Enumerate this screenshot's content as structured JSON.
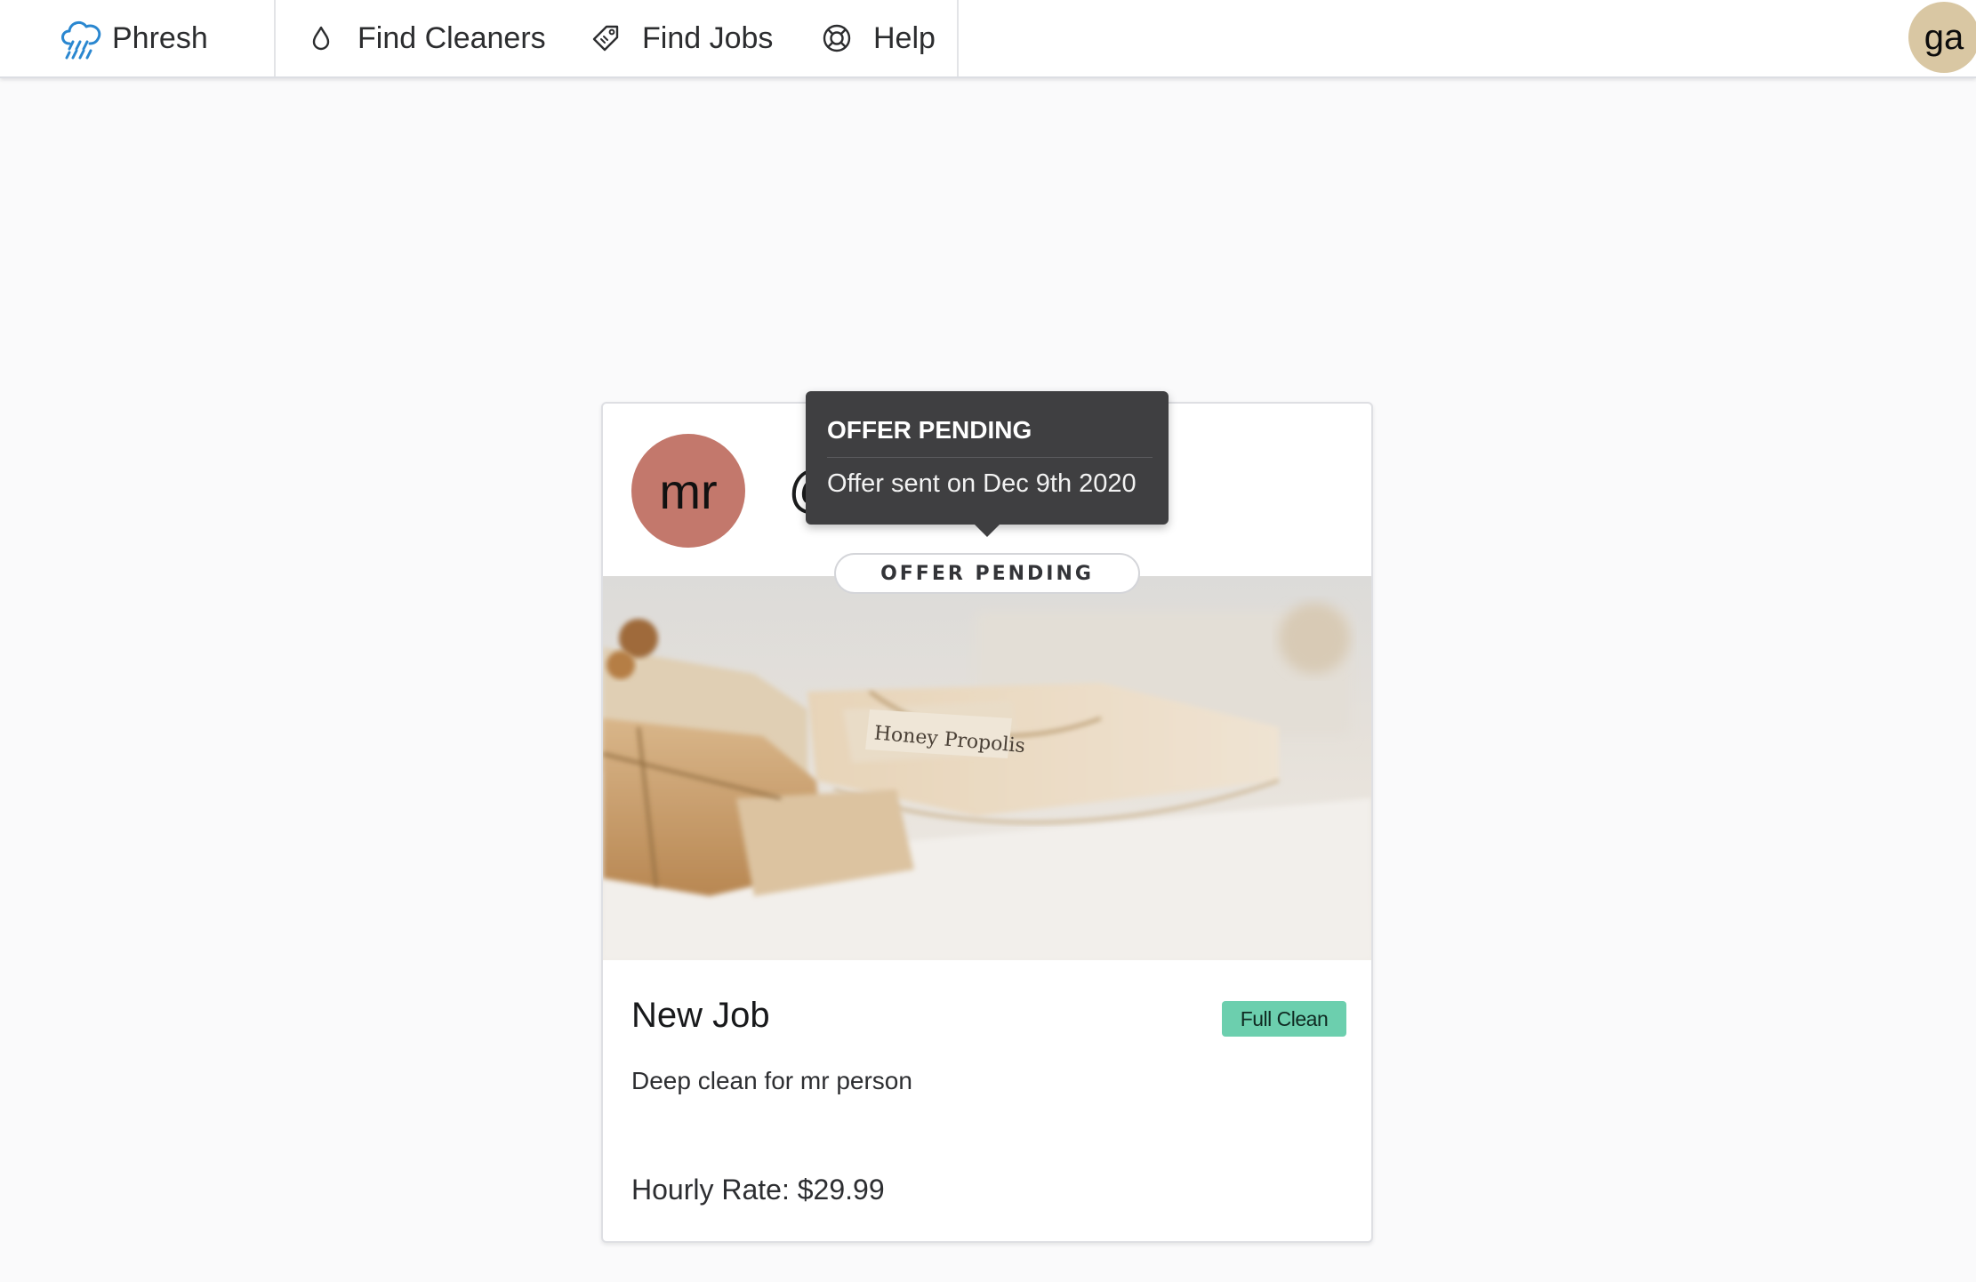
{
  "navbar": {
    "brand": {
      "label": "Phresh",
      "icon": "cloud-rain-icon"
    },
    "items": [
      {
        "label": "Find Cleaners",
        "icon": "droplet-icon"
      },
      {
        "label": "Find Jobs",
        "icon": "tag-icon"
      },
      {
        "label": "Help",
        "icon": "lifebuoy-icon"
      }
    ],
    "user_avatar": "ga",
    "brand_color": "#2a87d0"
  },
  "card": {
    "owner_avatar": "mr",
    "owner_avatar_color": "#c3786c",
    "at_glyph": "@",
    "status": "OFFER PENDING",
    "title": "New Job",
    "tag": "Full Clean",
    "tag_color": "#6ccfae",
    "description": "Deep clean for mr person",
    "rate": "Hourly Rate: $29.99"
  },
  "tooltip": {
    "header": "OFFER PENDING",
    "body": "Offer sent on Dec 9th 2020"
  }
}
